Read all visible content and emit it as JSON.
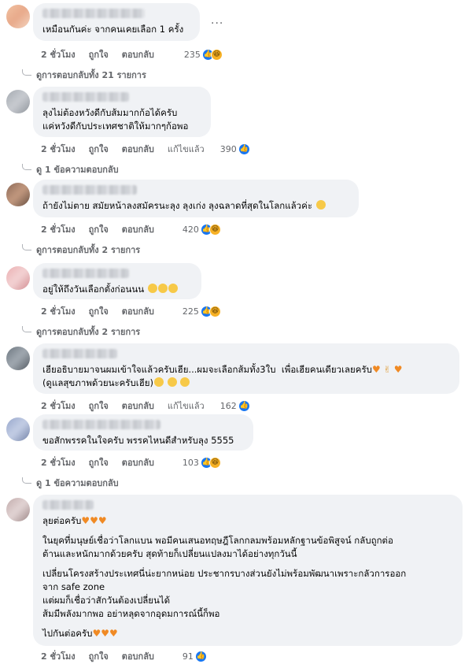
{
  "actions": {
    "time": "2 ชั่วโมง",
    "like": "ถูกใจ",
    "reply": "ตอบกลับ",
    "edited": "แก้ไขแล้ว"
  },
  "comments": [
    {
      "text": "เหมือนกันค่ะ จากคนเคยเลือก 1 ครั้ง",
      "count": "235",
      "reply_link": "ดูการตอบกลับทั้ง 21 รายการ"
    },
    {
      "lines": [
        "ลุงไม่ต้องหวังดีกับส้มมากก้อได้ครับ",
        "แค่หวังดีกับประเทศชาติให้มากๆก้อพอ"
      ],
      "count": "390",
      "reply_link": "ดู 1 ข้อความตอบกลับ"
    },
    {
      "text": "ถ้ายังไม่ตาย สมัยหน้าลงสมัครนะลุง ลุงเก่ง ลุงฉลาดที่สุดในโลกแล้วค่ะ",
      "count": "420",
      "reply_link": "ดูการตอบกลับทั้ง 2 รายการ"
    },
    {
      "text": "อยู่ให้ถึงวันเลือกตั้งก่อนนน",
      "count": "225",
      "reply_link": "ดูการตอบกลับทั้ง 2 รายการ"
    },
    {
      "lines": [
        "เฮียอธิบายมาจนผมเข้าใจแล้วครับเฮีย...ผมจะเลือกส้มทั้ง3ใบ  เพื่อเฮียคนเดียวเลยครับ",
        "(ดูแลสุขภาพด้วยนะครับเฮีย)"
      ],
      "count": "162"
    },
    {
      "text": "ขอสักพรรคในใจครับ พรรคไหนดีสำหรับลุง 5555",
      "count": "103",
      "reply_link": "ดู 1 ข้อความตอบกลับ"
    },
    {
      "paras": [
        [
          "ลุยต่อครับ"
        ],
        [
          "ในยุคที่มนุษย์เชื่อว่าโลกแบน พอมีคนเสนอทฤษฎีโลกกลมพร้อมหลักฐานข้อพิสูจน์ กลับถูกต่อ",
          "ต้านและหนักมากด้วยครับ สุดท้ายก็เปลี่ยนแปลงมาได้อย่างทุกวันนี้"
        ],
        [
          "เปลี่ยนโครงสร้างประเทศนี่น่ะยากหน่อย ประชากรบางส่วนยังไม่พร้อมพัฒนาเพราะกลัวการออก",
          "จาก safe zone",
          "แต่ผมก็เชื่อว่าสักวันต้องเปลี่ยนได้",
          "ส้มมีพลังมากพอ อย่าหลุดจากอุดมการณ์นี้ก็พอ"
        ],
        [
          "ไปกันต่อครับ"
        ]
      ],
      "count": "91"
    }
  ],
  "icons": {
    "like": "like-icon",
    "haha": "haha-icon",
    "care": "care-icon",
    "more": "more-options-icon",
    "reply_arrow": "reply-arrow-icon"
  },
  "colors": {
    "bubble": "#f0f2f5",
    "like_blue": "#1877f2",
    "muted": "#65676b",
    "heart_orange": "#f08a24"
  }
}
